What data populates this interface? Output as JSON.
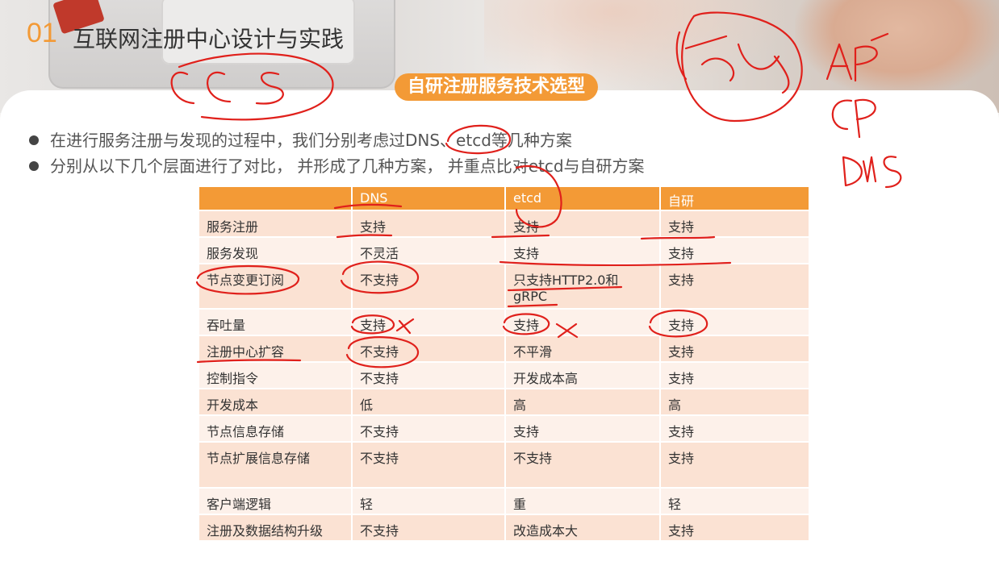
{
  "slide": {
    "number": "01",
    "title": "互联网注册中心设计与实践",
    "section_badge": "自研注册服务技术选型",
    "bullets": [
      "在进行服务注册与发现的过程中，我们分别考虑过DNS、etcd等几种方案",
      "分别从以下几个层面进行了对比，  并形成了几种方案，  并重点比对etcd与自研方案"
    ]
  },
  "table": {
    "columns": [
      "",
      "DNS",
      "etcd",
      "自研"
    ],
    "rows": [
      [
        "服务注册",
        "支持",
        "支持",
        "支持"
      ],
      [
        "服务发现",
        "不灵活",
        "支持",
        "支持"
      ],
      [
        "节点变更订阅",
        "不支持",
        "只支持HTTP2.0和gRPC",
        "支持"
      ],
      [
        "吞吐量",
        "支持",
        "支持",
        "支持"
      ],
      [
        "注册中心扩容",
        "不支持",
        "不平滑",
        "支持"
      ],
      [
        "控制指令",
        "不支持",
        "开发成本高",
        "支持"
      ],
      [
        "开发成本",
        "低",
        "高",
        "高"
      ],
      [
        "节点信息存储",
        "不支持",
        "支持",
        "支持"
      ],
      [
        "节点扩展信息存储",
        "不支持",
        "不支持",
        "支持"
      ],
      [
        "客户端逻辑",
        "轻",
        "重",
        "轻"
      ],
      [
        "注册及数据结构升级",
        "不支持",
        "改造成本大",
        "支持"
      ]
    ]
  },
  "colors": {
    "accent": "#f39a36",
    "row_odd": "#fbe2d3",
    "row_even": "#fdf1ea",
    "ink": "#e0201b"
  }
}
